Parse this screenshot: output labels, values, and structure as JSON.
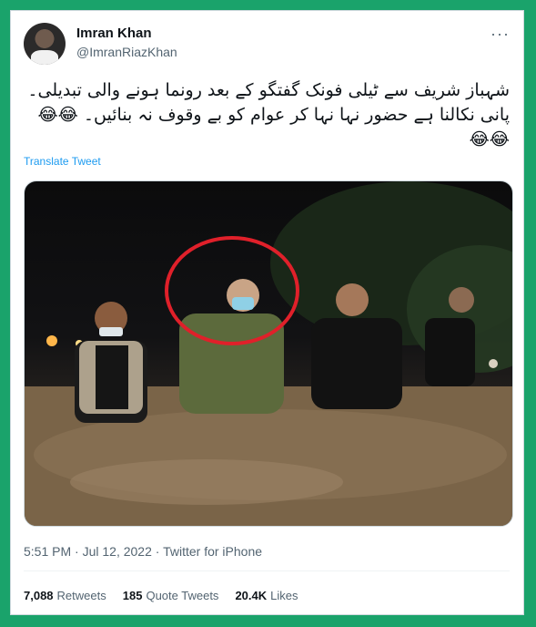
{
  "user": {
    "name": "Imran Khan",
    "handle": "@ImranRiazKhan"
  },
  "tweet": {
    "text": "شہباز شریف سے ٹیلی فونک گفتگو کے بعد رونما ہونے والی تبدیلی۔ پانی نکالنا ہے حضور نہا نہا کر عوام کو بے وقوف نہ بنائیں۔ 😂😂😂😂",
    "translate_label": "Translate Tweet",
    "timestamp": "5:51 PM · Jul 12, 2022",
    "source": "Twitter for iPhone"
  },
  "stats": {
    "retweets_count": "7,088",
    "retweets_label": "Retweets",
    "quotes_count": "185",
    "quotes_label": "Quote Tweets",
    "likes_count": "20.4K",
    "likes_label": "Likes"
  },
  "colors": {
    "frame": "#1aa36b",
    "link": "#1d9bf0",
    "circle_highlight": "#e0202a"
  },
  "icons": {
    "more": "more-horizontal-icon"
  }
}
